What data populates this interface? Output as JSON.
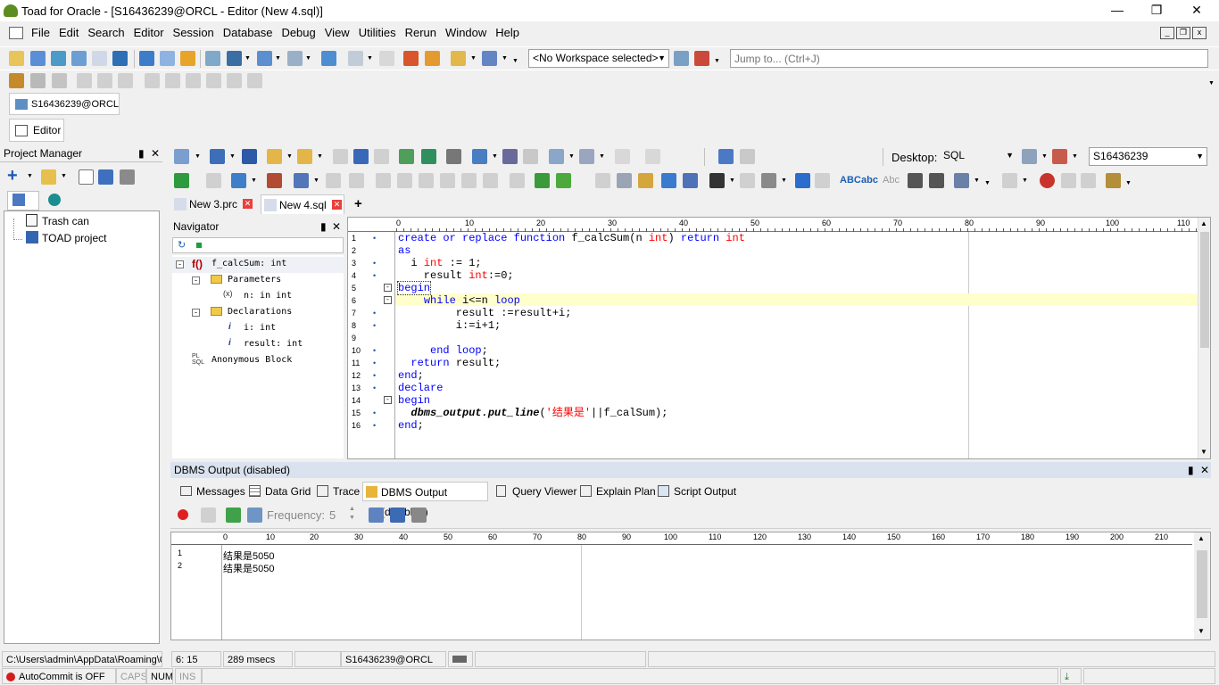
{
  "window": {
    "title": "Toad for Oracle - [S16436239@ORCL - Editor (New 4.sql)]"
  },
  "menu": [
    "File",
    "Edit",
    "Search",
    "Editor",
    "Session",
    "Database",
    "Debug",
    "View",
    "Utilities",
    "Rerun",
    "Window",
    "Help"
  ],
  "toolbar": {
    "workspace": "<No Workspace selected>",
    "jump_placeholder": "Jump to... (Ctrl+J)"
  },
  "connection_tab": "S16436239@ORCL",
  "editor_tab": "Editor",
  "project_manager": {
    "title": "Project Manager",
    "items": [
      "Trash can",
      "TOAD project"
    ]
  },
  "editor_toolbar": {
    "desktop_label": "Desktop:",
    "desktop_value": "SQL",
    "schema": "S16436239"
  },
  "file_tabs": [
    "New 3.prc",
    "New 4.sql"
  ],
  "navigator": {
    "title": "Navigator",
    "items": [
      "f_calcSum: int",
      "Parameters",
      "n: in int",
      "Declarations",
      "i: int",
      "result: int",
      "Anonymous Block"
    ]
  },
  "ruler": [
    "0",
    "10",
    "20",
    "30",
    "40",
    "50",
    "60",
    "70",
    "80",
    "90",
    "100",
    "110"
  ],
  "code_lines": [
    "create or replace function f_calcSum(n int) return int",
    "as",
    "  i int := 1;",
    "    result int:=0;",
    "begin",
    "    while i<=n loop",
    "         result :=result+i;",
    "         i:=i+1;",
    "",
    "     end loop;",
    "  return result;",
    "end;",
    "declare",
    "begin",
    "  dbms_output.put_line('结果是'||f_calSum);",
    "end;"
  ],
  "output": {
    "title": "DBMS Output (disabled)",
    "tabs": [
      "Messages",
      "Data Grid",
      "Trace",
      "DBMS Output (disabled)",
      "Query Viewer",
      "Explain Plan",
      "Script Output"
    ],
    "frequency_label": "Frequency:",
    "frequency_value": "5",
    "ruler": [
      "0",
      "10",
      "20",
      "30",
      "40",
      "50",
      "60",
      "70",
      "80",
      "90",
      "100",
      "110",
      "120",
      "130",
      "140",
      "150",
      "160",
      "170",
      "180",
      "190",
      "200",
      "210"
    ],
    "lines": [
      "结果是5050",
      "结果是5050"
    ]
  },
  "status": {
    "path": "C:\\Users\\admin\\AppData\\Roaming\\Q",
    "position": "6: 15",
    "time": "289 msecs",
    "connection": "S16436239@ORCL",
    "autocommit": "AutoCommit is OFF",
    "caps": "CAPS",
    "num": "NUM",
    "ins": "INS"
  }
}
